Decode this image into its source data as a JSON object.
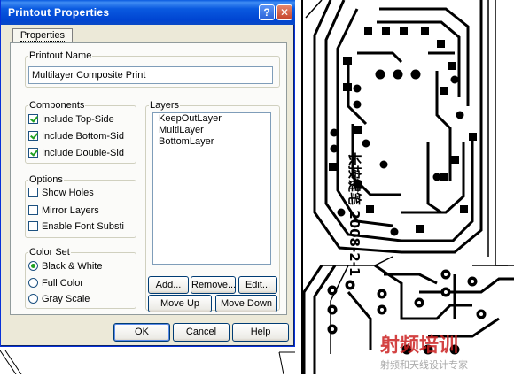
{
  "window": {
    "title": "Printout Properties",
    "help_glyph": "?",
    "close_glyph": "✕"
  },
  "tab": {
    "label": "Properties"
  },
  "printout_name": {
    "label": "Printout Name",
    "value": "Multilayer Composite Print"
  },
  "components": {
    "label": "Components",
    "items": [
      {
        "label": "Include Top-Side",
        "checked": true
      },
      {
        "label": "Include Bottom-Sid",
        "checked": true
      },
      {
        "label": "Include Double-Sid",
        "checked": true
      }
    ]
  },
  "options": {
    "label": "Options",
    "items": [
      {
        "label": "Show Holes",
        "checked": false
      },
      {
        "label": "Mirror Layers",
        "checked": false
      },
      {
        "label": "Enable Font Substi",
        "checked": false
      }
    ]
  },
  "color_set": {
    "label": "Color Set",
    "items": [
      {
        "label": "Black & White",
        "selected": true
      },
      {
        "label": "Full Color",
        "selected": false
      },
      {
        "label": "Gray Scale",
        "selected": false
      }
    ]
  },
  "layers": {
    "label": "Layers",
    "items": [
      "KeepOutLayer",
      "MultiLayer",
      "BottomLayer"
    ]
  },
  "layer_buttons": {
    "add": "Add...",
    "remove": "Remove...",
    "edit": "Edit...",
    "move_up": "Move Up",
    "move_down": "Move Down"
  },
  "footer": {
    "ok": "OK",
    "cancel": "Cancel",
    "help": "Help"
  },
  "pcb": {
    "silkscreen_text": "长按键笔 2008-2-1",
    "watermark_title": "射频培训",
    "watermark_sub": "射频和天线设计专家"
  },
  "colors": {
    "titlebar": "#0a5ae0",
    "dialog_bg": "#ece9d8",
    "check_green": "#21a121",
    "watermark_red": "#cc2222"
  }
}
